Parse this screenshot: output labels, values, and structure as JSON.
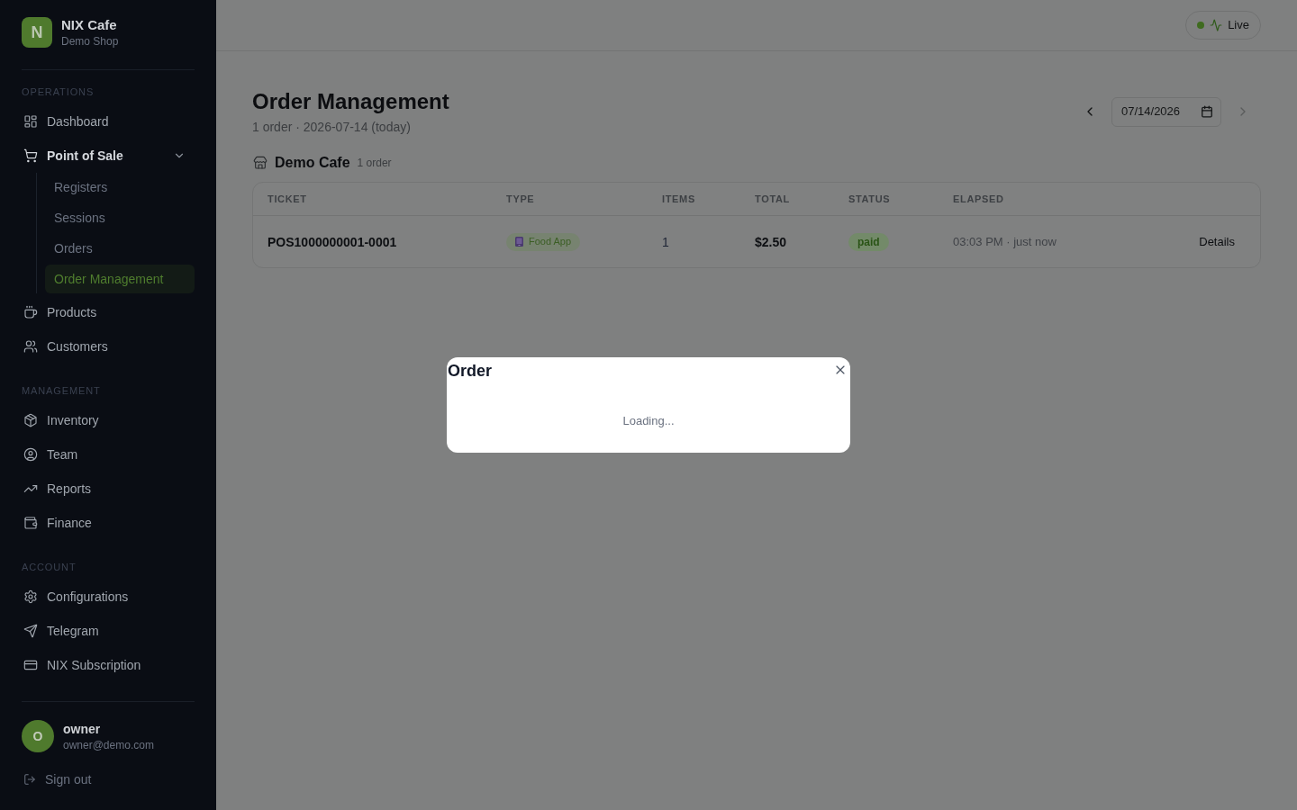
{
  "sidebar": {
    "brand": {
      "logo_letter": "N",
      "name": "NIX Cafe",
      "subtitle": "Demo Shop"
    },
    "sections": [
      {
        "title": "OPERATIONS",
        "items": [
          {
            "label": "Dashboard",
            "selected": false
          },
          {
            "label": "Point of Sale",
            "selected": false,
            "expanded": true,
            "children": [
              {
                "label": "Registers",
                "selected": false
              },
              {
                "label": "Sessions",
                "selected": false
              },
              {
                "label": "Orders",
                "selected": false
              },
              {
                "label": "Order Management",
                "selected": true
              }
            ]
          },
          {
            "label": "Products",
            "selected": false
          },
          {
            "label": "Customers",
            "selected": false
          }
        ]
      },
      {
        "title": "MANAGEMENT",
        "items": [
          {
            "label": "Inventory",
            "selected": false
          },
          {
            "label": "Team",
            "selected": false
          },
          {
            "label": "Reports",
            "selected": false
          },
          {
            "label": "Finance",
            "selected": false
          }
        ]
      },
      {
        "title": "ACCOUNT",
        "items": [
          {
            "label": "Configurations",
            "selected": false
          },
          {
            "label": "Telegram",
            "selected": false
          },
          {
            "label": "NIX Subscription",
            "selected": false
          }
        ]
      }
    ],
    "user": {
      "avatar_letter": "O",
      "name": "owner",
      "email": "owner@demo.com"
    },
    "sign_out": "Sign out"
  },
  "top_bar": {
    "live": {
      "label": "Live",
      "on": true
    }
  },
  "page": {
    "title": "Order Management",
    "subtitle": "1 order · 2026-07-14 (today)",
    "date_nav": {
      "previous": {
        "disabled": false
      },
      "date": {
        "value": "07/14/2026"
      },
      "next": {
        "disabled": true
      }
    }
  },
  "location": {
    "name": "Demo Cafe",
    "count": "1 order"
  },
  "table": {
    "columns": [
      "TICKET",
      "TYPE",
      "ITEMS",
      "TOTAL",
      "STATUS",
      "ELAPSED"
    ],
    "rows": [
      {
        "ticket": "POS1000000001-0001",
        "type": "Food App",
        "items": "1",
        "total": "$2.50",
        "status": "paid",
        "elapsed": "03:03 PM · just now",
        "action": "Details"
      }
    ]
  },
  "dialog": {
    "title": "Order",
    "message": "Loading..."
  }
}
